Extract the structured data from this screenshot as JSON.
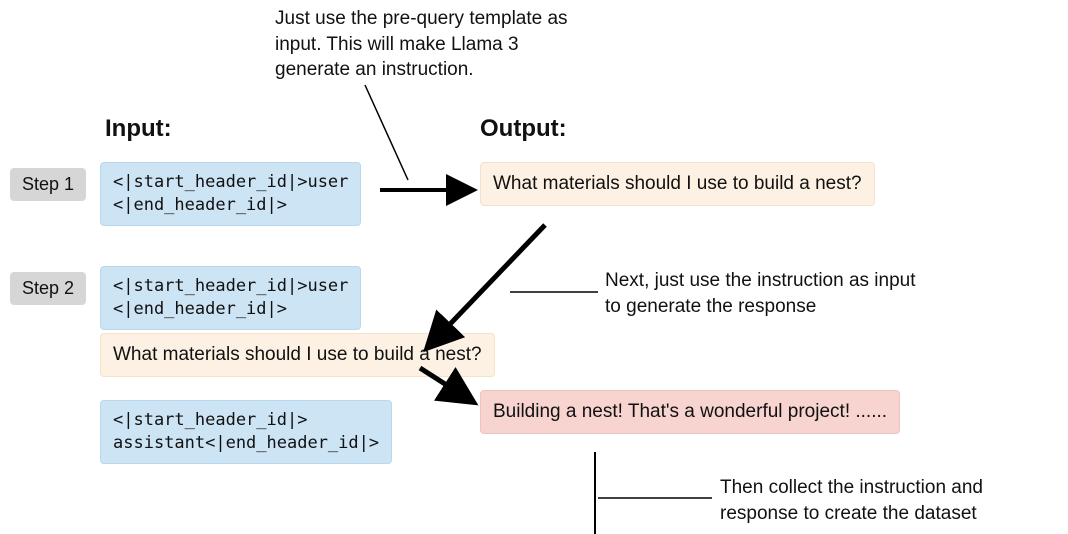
{
  "annotations": {
    "top": "Just use the pre-query template\nas input. This will make Llama 3\ngenerate an instruction.",
    "right1": "Next, just use the instruction as\ninput to generate the response",
    "bottom": "Then collect the instruction and\nresponse to create the dataset"
  },
  "headings": {
    "input": "Input:",
    "output": "Output:"
  },
  "steps": {
    "step1_label": "Step 1",
    "step2_label": "Step 2"
  },
  "boxes": {
    "step1_input": "<|start_header_id|>user\n<|end_header_id|>",
    "step1_output": "What materials should I\nuse to build a nest?",
    "step2_input_a": "<|start_header_id|>user\n<|end_header_id|>",
    "step2_input_b": "What materials should I\nuse to build a nest?",
    "step2_input_c": "<|start_header_id|>\nassistant<|end_header_id|>",
    "step2_output": "Building a nest! That's a\nwonderful project! ......"
  },
  "colors": {
    "blue": "#cde4f4",
    "cream": "#fdf1e4",
    "pink": "#f8d4d0",
    "grey": "#d6d6d6"
  }
}
